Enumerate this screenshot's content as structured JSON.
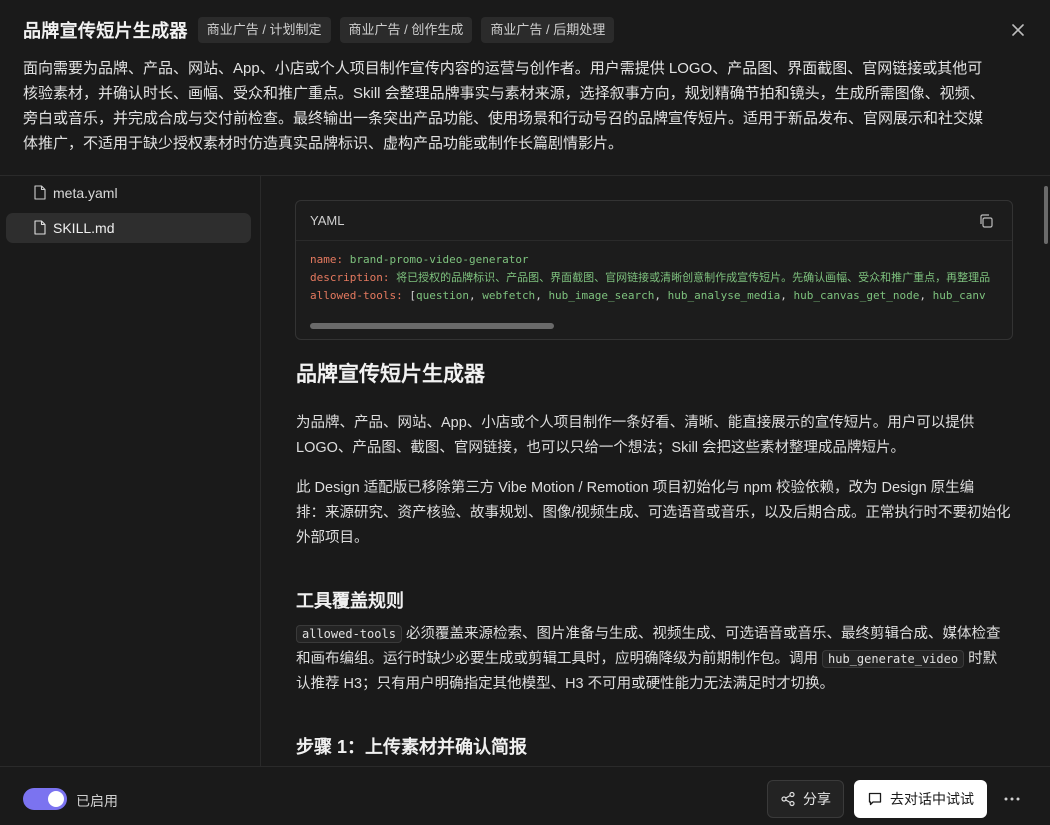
{
  "header": {
    "title": "品牌宣传短片生成器",
    "tags": [
      "商业广告 / 计划制定",
      "商业广告 / 创作生成",
      "商业广告 / 后期处理"
    ],
    "description_lines": [
      "面向需要为品牌、产品、网站、App、小店或个人项目制作宣传内容的运营与创作者。用户需提供 LOGO、产品图、界面截图、官网链接或其他可",
      "核验素材，并确认时长、画幅、受众和推广重点。Skill 会整理品牌事实与素材来源，选择叙事方向，规划精确节拍和镜头，生成所需图像、视频、",
      "旁白或音乐，并完成合成与交付前检查。最终输出一条突出产品功能、使用场景和行动号召的品牌宣传短片。适用于新品发布、官网展示和社交媒",
      "体推广，不适用于缺少授权素材时仿造真实品牌标识、虚构产品功能或制作长篇剧情影片。"
    ],
    "close_icon": "close-icon"
  },
  "sidebar": {
    "files": [
      {
        "name": "meta.yaml",
        "icon": "file-icon"
      },
      {
        "name": "SKILL.md",
        "icon": "file-icon"
      }
    ]
  },
  "code": {
    "lang": "YAML",
    "copy_icon": "copy-icon",
    "lines": [
      {
        "key": "name:",
        "value": "brand-promo-video-generator"
      },
      {
        "key": "description:",
        "value": "将已授权的品牌标识、产品图、界面截图、官网链接或清晰创意制作成宣传短片。先确认画幅、受众和推广重点，再整理品"
      },
      {
        "key": "allowed-tools:",
        "punct": " [",
        "items": [
          "question",
          "webfetch",
          "hub_image_search",
          "hub_analyse_media",
          "hub_canvas_get_node",
          "hub_canv"
        ]
      }
    ]
  },
  "doc": {
    "h1": "品牌宣传短片生成器",
    "p1_lines": [
      "为品牌、产品、网站、App、小店或个人项目制作一条好看、清晰、能直接展示的宣传短片。用户可以提供",
      "LOGO、产品图、截图、官网链接，也可以只给一个想法；Skill 会把这些素材整理成品牌短片。"
    ],
    "p2_lines": [
      "此 Design 适配版已移除第三方 Vibe Motion / Remotion 项目初始化与 npm 校验依赖，改为 Design 原生编",
      "排：来源研究、资产核验、故事规划、图像/视频生成、可选语音或音乐，以及后期合成。正常执行时不要初始化",
      "外部项目。"
    ],
    "h2_tools": "工具覆盖规则",
    "tools_para": {
      "code1": "allowed-tools",
      "text1": " 必须覆盖来源检索、图片准备与生成、视频生成、可选语音或音乐、最终剪辑合成、媒体检查",
      "text2": "和画布编组。运行时缺少必要生成或剪辑工具时，应明确降级为前期制作包。调用 ",
      "code2": "hub_generate_video",
      "text3": " 时默",
      "text4": "认推荐 H3；只有用户明确指定其他模型、H3 不可用或硬性能力无法满足时才切换。"
    },
    "h2_step1": "步骤 1：上传素材并确认简报"
  },
  "footer": {
    "toggle_on": true,
    "toggle_label": "已启用",
    "share_label": "分享",
    "share_icon": "share-icon",
    "try_label": "去对话中试试",
    "try_icon": "chat-icon",
    "more_icon": "more-icon"
  }
}
